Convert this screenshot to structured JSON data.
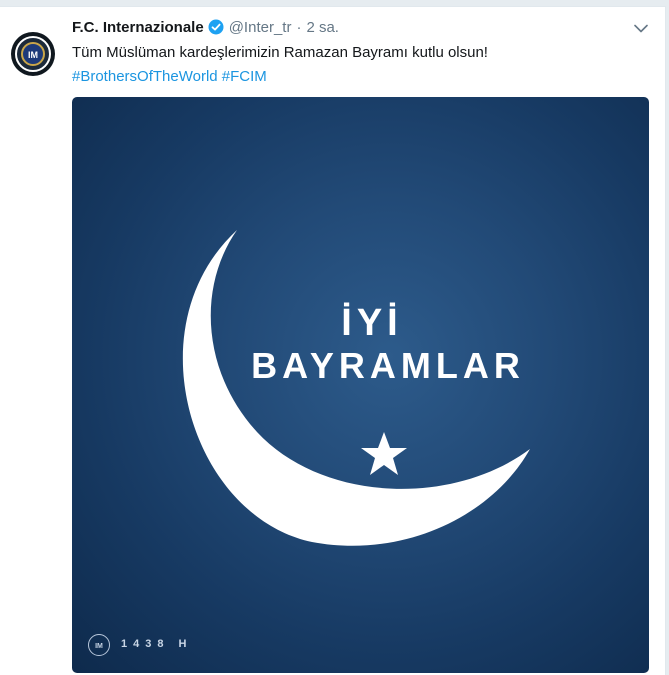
{
  "tweet": {
    "author_name": "F.C. Internazionale",
    "handle": "@Inter_tr",
    "separator": "·",
    "time": "2 sa.",
    "text": "Tüm Müslüman kardeşlerimizin Ramazan Bayramı kutlu olsun!",
    "hashtags": [
      "#BrothersOfTheWorld",
      "#FCIM"
    ]
  },
  "media": {
    "line1": "İYİ",
    "line2": "BAYRAMLAR",
    "year": "1438 H"
  },
  "icons": {
    "avatar": "inter-logo-icon",
    "verified": "verified-badge-icon",
    "menu": "chevron-down-icon",
    "moon": "crescent-moon-icon",
    "star": "star-icon",
    "footer": "inter-logo-icon"
  },
  "colors": {
    "link": "#1b95e0",
    "verified": "#1da1f2",
    "image_bg": "#1f4672"
  }
}
